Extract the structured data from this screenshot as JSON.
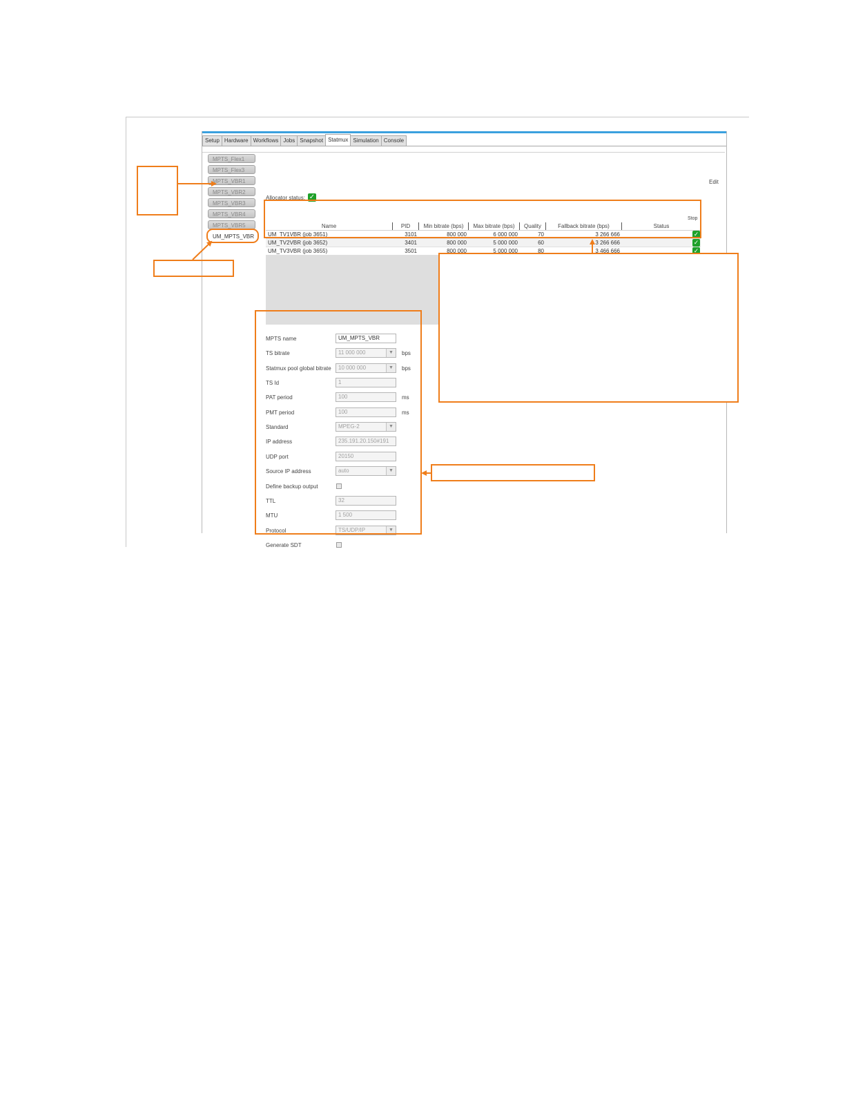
{
  "tabs": [
    {
      "label": "Setup",
      "active": false
    },
    {
      "label": "Hardware",
      "active": false
    },
    {
      "label": "Workflows",
      "active": false
    },
    {
      "label": "Jobs",
      "active": false
    },
    {
      "label": "Snapshot",
      "active": false
    },
    {
      "label": "Statmux",
      "active": true
    },
    {
      "label": "Simulation",
      "active": false
    },
    {
      "label": "Console",
      "active": false
    }
  ],
  "sidebar": {
    "items": [
      {
        "label": "MPTS_Flex1",
        "active": false
      },
      {
        "label": "MPTS_Flex3",
        "active": false
      },
      {
        "label": "MPTS_VBR1",
        "active": false
      },
      {
        "label": "MPTS_VBR2",
        "active": false
      },
      {
        "label": "MPTS_VBR3",
        "active": false
      },
      {
        "label": "MPTS_VBR4",
        "active": false
      },
      {
        "label": "MPTS_VBR5",
        "active": false
      },
      {
        "label": "UM_MPTS_VBR",
        "active": true
      }
    ]
  },
  "edit_label": "Edit",
  "allocator_label": "Allocator status:",
  "stop_label": "Stop",
  "accent_colors": {
    "annotation": "#ef7d1a",
    "status_ok": "#1fa12a",
    "top_bar": "#3aa0de"
  },
  "table": {
    "headers": [
      "Name",
      "PID",
      "Min bitrate (bps)",
      "Max bitrate (bps)",
      "Quality",
      "Fallback bitrate (bps)",
      "Status"
    ],
    "rows": [
      [
        "UM_TV1VBR (job 3651)",
        "3101",
        "800 000",
        "6 000 000",
        "70",
        "3 266 666"
      ],
      [
        "UM_TV2VBR (job 3652)",
        "3401",
        "800 000",
        "5 000 000",
        "60",
        "3 266 666"
      ],
      [
        "UM_TV3VBR (job 3655)",
        "3501",
        "800 000",
        "5 000 000",
        "80",
        "3 466 666"
      ]
    ]
  },
  "form": {
    "fields": [
      {
        "label": "MPTS name",
        "value": "UM_MPTS_VBR",
        "unit": "",
        "type": "text",
        "editable": true
      },
      {
        "label": "TS bitrate",
        "value": "11 000 000",
        "unit": "bps",
        "type": "select",
        "editable": false
      },
      {
        "label": "Statmux pool global bitrate",
        "value": "10 000 000",
        "unit": "bps",
        "type": "select",
        "editable": false
      },
      {
        "label": "TS Id",
        "value": "1",
        "unit": "",
        "type": "text",
        "editable": false
      },
      {
        "label": "PAT period",
        "value": "100",
        "unit": "ms",
        "type": "text",
        "editable": false
      },
      {
        "label": "PMT period",
        "value": "100",
        "unit": "ms",
        "type": "text",
        "editable": false
      },
      {
        "label": "Standard",
        "value": "MPEG-2",
        "unit": "",
        "type": "select",
        "editable": false
      },
      {
        "label": "IP address",
        "value": "235.191.20.150#191",
        "unit": "",
        "type": "text",
        "editable": false
      },
      {
        "label": "UDP port",
        "value": "20150",
        "unit": "",
        "type": "text",
        "editable": false
      },
      {
        "label": "Source IP address",
        "value": "auto",
        "unit": "",
        "type": "select",
        "editable": false
      },
      {
        "label": "Define backup output",
        "value": "",
        "unit": "",
        "type": "checkbox",
        "editable": false
      },
      {
        "label": "TTL",
        "value": "32",
        "unit": "",
        "type": "text",
        "editable": false
      },
      {
        "label": "MTU",
        "value": "1 500",
        "unit": "",
        "type": "text",
        "editable": false
      },
      {
        "label": "Protocol",
        "value": "TS/UDP/IP",
        "unit": "",
        "type": "select",
        "editable": false
      },
      {
        "label": "Generate SDT",
        "value": "",
        "unit": "",
        "type": "checkbox",
        "editable": false
      }
    ]
  }
}
